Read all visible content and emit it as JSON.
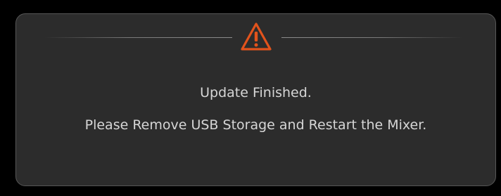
{
  "dialog": {
    "icon": "warning-triangle-icon",
    "accent_color": "#e2531c",
    "title": "Update Finished.",
    "message": "Please Remove USB Storage and Restart the Mixer."
  }
}
